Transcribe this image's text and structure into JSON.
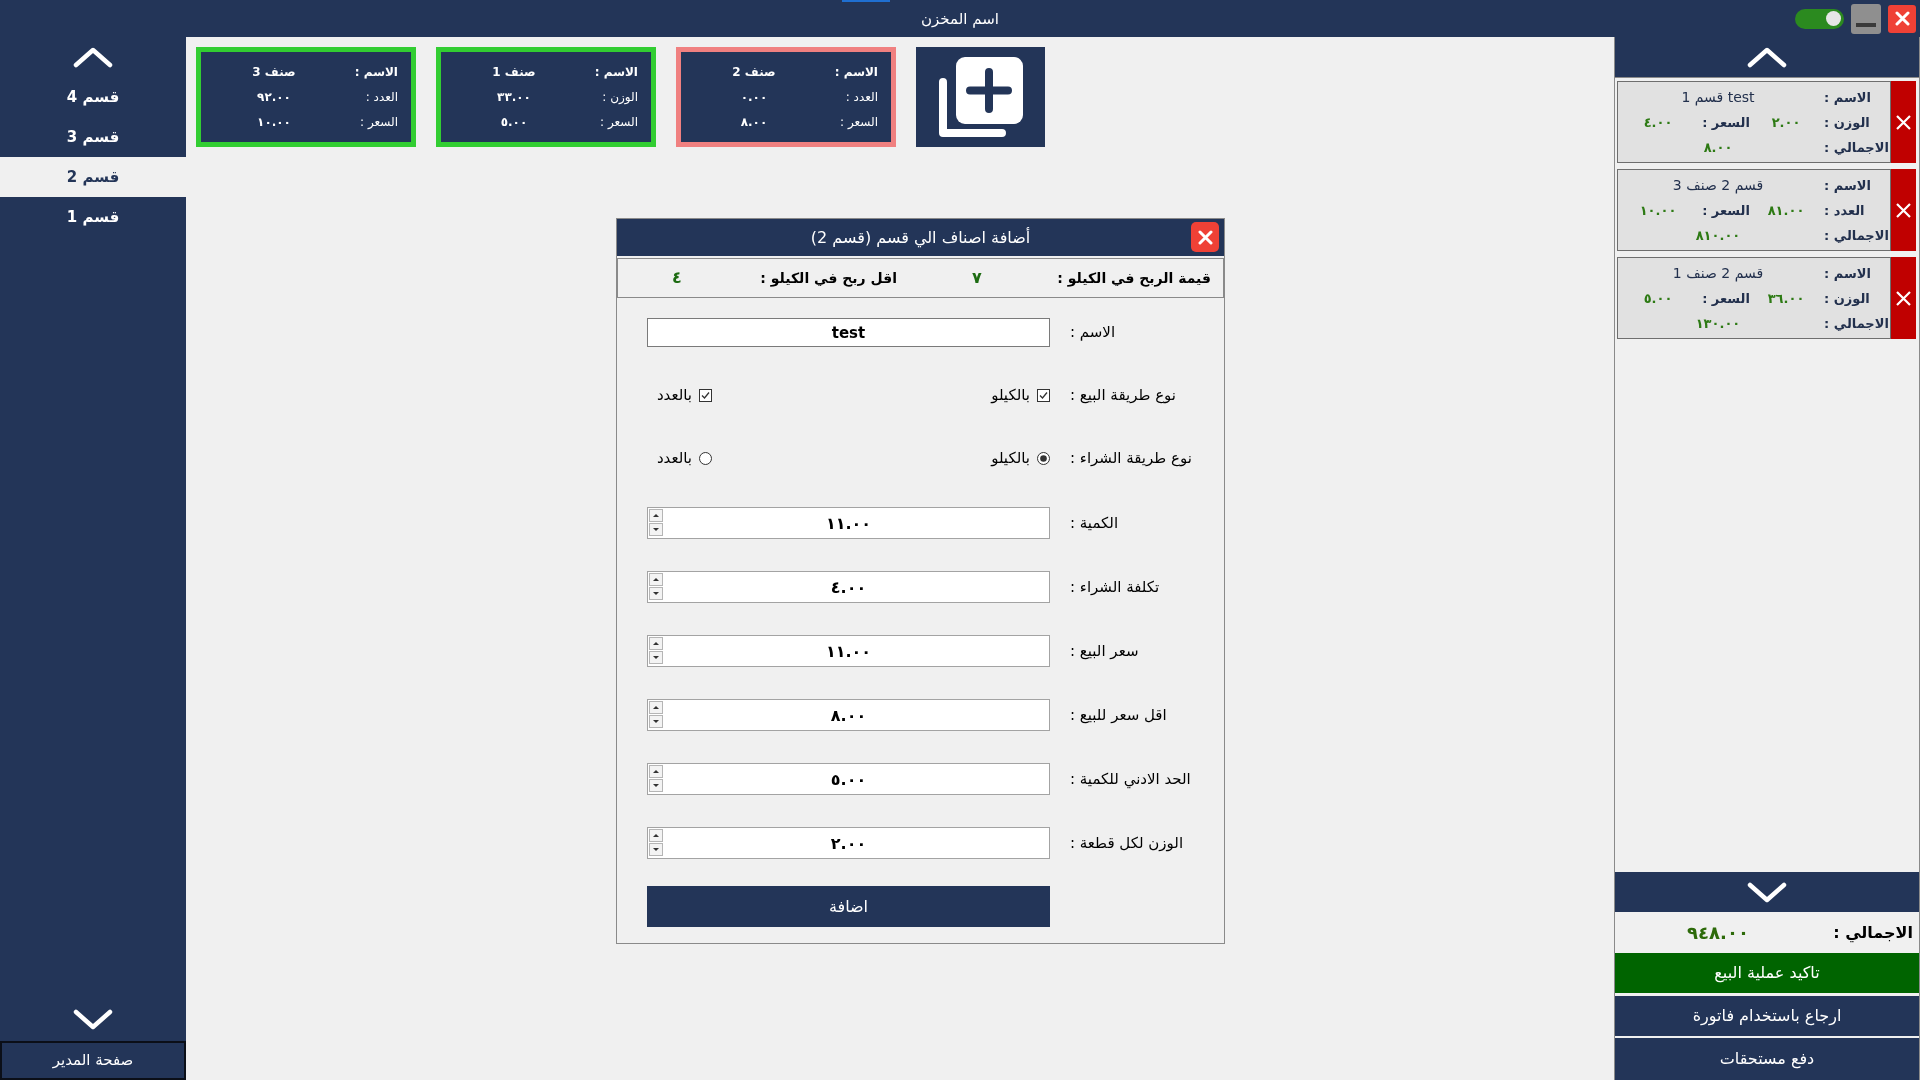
{
  "window": {
    "title": "اسم المخزن",
    "toggle": {
      "on": true
    }
  },
  "sidebar": {
    "items": [
      {
        "label": "قسم 4",
        "selected": false
      },
      {
        "label": "قسم 3",
        "selected": false
      },
      {
        "label": "قسم 2",
        "selected": true
      },
      {
        "label": "قسم 1",
        "selected": false
      }
    ],
    "footer_button": "صفحة المدير"
  },
  "item_cards": [
    {
      "color": "#f08080",
      "rows": [
        {
          "label": "الاسم :",
          "value": "صنف 2"
        },
        {
          "label": "العدد :",
          "value": "٠.٠٠"
        },
        {
          "label": "السعر :",
          "value": "٨.٠٠"
        }
      ]
    },
    {
      "color": "#32cd32",
      "rows": [
        {
          "label": "الاسم :",
          "value": "صنف 1"
        },
        {
          "label": "الوزن :",
          "value": "٣٣.٠٠"
        },
        {
          "label": "السعر :",
          "value": "٥.٠٠"
        }
      ]
    },
    {
      "color": "#32cd32",
      "rows": [
        {
          "label": "الاسم :",
          "value": "صنف 3"
        },
        {
          "label": "العدد :",
          "value": "٩٢.٠٠"
        },
        {
          "label": "السعر :",
          "value": "١٠.٠٠"
        }
      ]
    }
  ],
  "dialog": {
    "title": "أضافة اصناف الي قسم (قسم 2)",
    "summary": [
      {
        "label": "قيمة الربح في الكيلو :",
        "value": "٧"
      },
      {
        "label": "اقل ربح في الكيلو :",
        "value": "٤"
      }
    ],
    "fields": [
      {
        "kind": "text",
        "label": "الاسم :",
        "value": "test"
      },
      {
        "kind": "checkboxes",
        "label": "نوع طريقة البيع :",
        "options": [
          {
            "label": "بالكيلو",
            "checked": true
          },
          {
            "label": "بالعدد",
            "checked": true
          }
        ]
      },
      {
        "kind": "radios",
        "label": "نوع طريقة الشراء :",
        "options": [
          {
            "label": "بالكيلو",
            "selected": true
          },
          {
            "label": "بالعدد",
            "selected": false
          }
        ]
      },
      {
        "kind": "number",
        "label": "الكمية :",
        "value": "١١.٠٠"
      },
      {
        "kind": "number",
        "label": "تكلفة الشراء :",
        "value": "٤.٠٠"
      },
      {
        "kind": "number",
        "label": "سعر البيع :",
        "value": "١١.٠٠"
      },
      {
        "kind": "number",
        "label": "اقل سعر للبيع :",
        "value": "٨.٠٠"
      },
      {
        "kind": "number",
        "label": "الحد الادني للكمية :",
        "value": "٥.٠٠"
      },
      {
        "kind": "number",
        "label": "الوزن لكل قطعة :",
        "value": "٢.٠٠"
      }
    ],
    "submit_button": "اضافة"
  },
  "cart": {
    "items": [
      {
        "name_label": "الاسم :",
        "name": "قسم 1 test",
        "quantity_label": "الوزن :",
        "quantity": "٢.٠٠",
        "price_label": "السعر :",
        "price": "٤.٠٠",
        "total_label": "الاجمالي :",
        "total": "٨.٠٠"
      },
      {
        "name_label": "الاسم :",
        "name": "قسم 2 صنف 3",
        "quantity_label": "العدد :",
        "quantity": "٨١.٠٠",
        "price_label": "السعر :",
        "price": "١٠.٠٠",
        "total_label": "الاجمالي :",
        "total": "٨١٠.٠٠"
      },
      {
        "name_label": "الاسم :",
        "name": "قسم 2 صنف 1",
        "quantity_label": "الوزن :",
        "quantity": "٣٦.٠٠",
        "price_label": "السعر :",
        "price": "٥.٠٠",
        "total_label": "الاجمالي :",
        "total": "١٣٠.٠٠"
      }
    ],
    "total_label": "الاجمالي :",
    "total": "٩٤٨.٠٠",
    "buttons": [
      {
        "kind": "primary",
        "label": "تاكيد عملية البيع"
      },
      {
        "kind": "secondary",
        "label": "ارجاع باستخدام فاتورة"
      },
      {
        "kind": "secondary",
        "label": "دفع مستحقات"
      }
    ]
  }
}
